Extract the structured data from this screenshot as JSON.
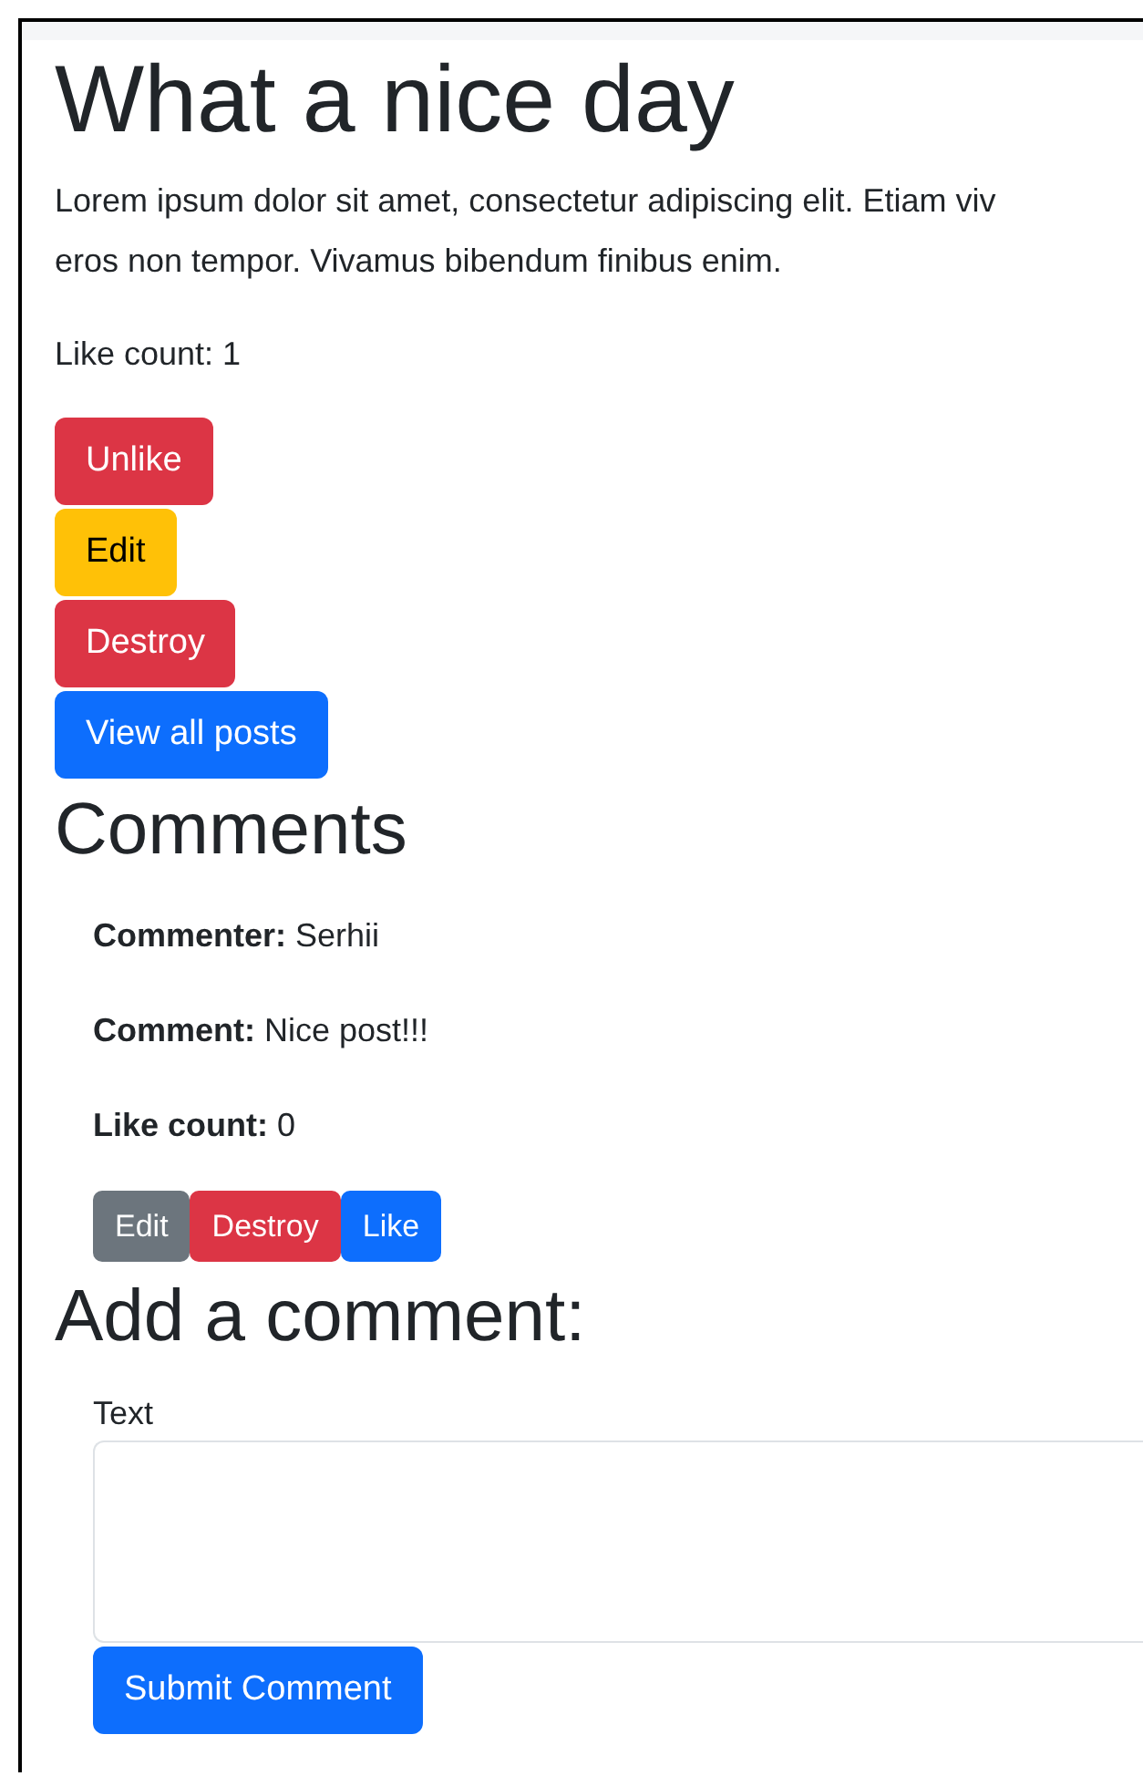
{
  "post": {
    "title": "What a nice day",
    "body_lines": [
      "Lorem ipsum dolor sit amet, consectetur adipiscing elit. Etiam viv",
      "eros non tempor. Vivamus bibendum finibus enim."
    ],
    "like_count": "Like count: 1"
  },
  "post_actions": [
    {
      "label": "Unlike",
      "kind": "danger"
    },
    {
      "label": "Edit",
      "kind": "warning"
    },
    {
      "label": "Destroy",
      "kind": "danger"
    },
    {
      "label": "View all posts",
      "kind": "primary"
    }
  ],
  "comments_heading": "Comments",
  "comments": [
    {
      "fields": [
        {
          "label": "Commenter:",
          "value": "Serhii"
        },
        {
          "label": "Comment:",
          "value": "Nice post!!!"
        },
        {
          "label": "Like count:",
          "value": "0"
        }
      ],
      "actions": [
        {
          "label": "Edit",
          "kind": "secondary"
        },
        {
          "label": "Destroy",
          "kind": "danger"
        },
        {
          "label": "Like",
          "kind": "primary"
        }
      ]
    }
  ],
  "form": {
    "heading": "Add a comment:",
    "field_label": "Text",
    "submit": "Submit Comment"
  }
}
